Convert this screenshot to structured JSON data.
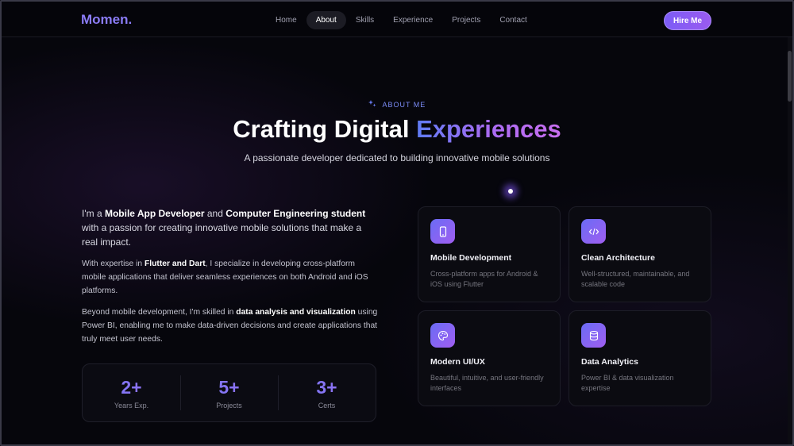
{
  "nav": {
    "logo": "Momen.",
    "links": [
      "Home",
      "About",
      "Skills",
      "Experience",
      "Projects",
      "Contact"
    ],
    "active": "About",
    "cta": "Hire Me"
  },
  "hero": {
    "tag": "ABOUT ME",
    "title_plain": "Crafting Digital",
    "title_accent": "Experiences",
    "subtitle": "A passionate developer dedicated to building innovative mobile solutions"
  },
  "about": {
    "p1_a": "I'm a ",
    "p1_b": "Mobile App Developer",
    "p1_c": " and ",
    "p1_d": "Computer Engineering student",
    "p1_e": " with a passion for creating innovative mobile solutions that make a real impact.",
    "p2_a": "With expertise in ",
    "p2_b": "Flutter and Dart",
    "p2_c": ", I specialize in developing cross-platform mobile applications that deliver seamless experiences on both Android and iOS platforms.",
    "p3_a": "Beyond mobile development, I'm skilled in ",
    "p3_b": "data analysis and visualization",
    "p3_c": " using Power BI, enabling me to make data-driven decisions and create applications that truly meet user needs."
  },
  "stats": [
    {
      "value": "2+",
      "label": "Years Exp."
    },
    {
      "value": "5+",
      "label": "Projects"
    },
    {
      "value": "3+",
      "label": "Certs"
    }
  ],
  "cards": [
    {
      "icon": "mobile-icon",
      "title": "Mobile Development",
      "desc": "Cross-platform apps for Android & iOS using Flutter"
    },
    {
      "icon": "code-icon",
      "title": "Clean Architecture",
      "desc": "Well-structured, maintainable, and scalable code"
    },
    {
      "icon": "palette-icon",
      "title": "Modern UI/UX",
      "desc": "Beautiful, intuitive, and user-friendly interfaces"
    },
    {
      "icon": "database-icon",
      "title": "Data Analytics",
      "desc": "Power BI & data visualization expertise"
    }
  ],
  "colors": {
    "accent": "#8b7cf6",
    "gradient_start": "#5f7cf5",
    "gradient_end": "#c96ef0",
    "background": "#06060c"
  }
}
